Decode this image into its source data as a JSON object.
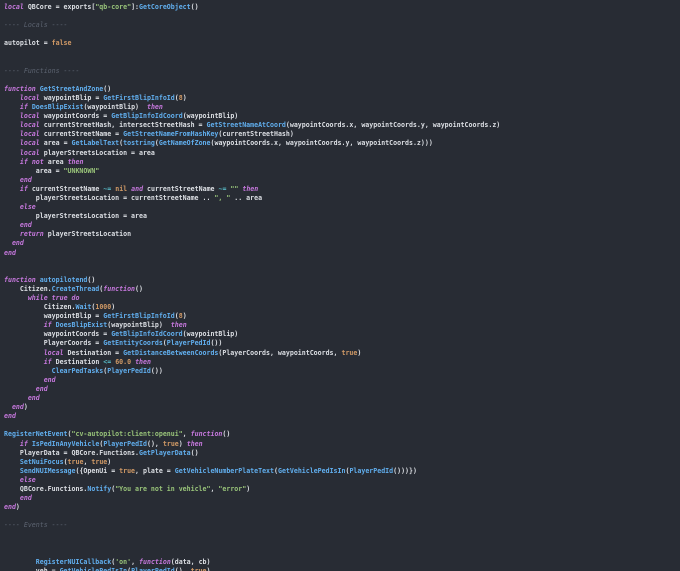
{
  "colors": {
    "background": "#282c34",
    "text": "#dcdfe4",
    "keyword": "#c678dd",
    "function": "#61afef",
    "string": "#98c379",
    "number": "#d19a66",
    "operator": "#56b6c2",
    "comment": "#5c6370"
  },
  "lines": [
    [
      {
        "t": "kw",
        "v": "local"
      },
      {
        "t": "tx",
        "v": " QBCore = exports["
      },
      {
        "t": "str",
        "v": "\"qb-core\""
      },
      {
        "t": "tx",
        "v": "]:"
      },
      {
        "t": "fn",
        "v": "GetCoreObject"
      },
      {
        "t": "tx",
        "v": "()"
      }
    ],
    [],
    [
      {
        "t": "cm",
        "v": "---- Locals ----"
      }
    ],
    [],
    [
      {
        "t": "tx",
        "v": "autopilot = "
      },
      {
        "t": "num",
        "v": "false"
      }
    ],
    [],
    [],
    [
      {
        "t": "cm",
        "v": "---- Functions ----"
      }
    ],
    [],
    [
      {
        "t": "kw",
        "v": "function"
      },
      {
        "t": "tx",
        "v": " "
      },
      {
        "t": "fn",
        "v": "GetStreetAndZone"
      },
      {
        "t": "tx",
        "v": "()"
      }
    ],
    [
      {
        "t": "tx",
        "v": "    "
      },
      {
        "t": "kw",
        "v": "local"
      },
      {
        "t": "tx",
        "v": " waypointBlip = "
      },
      {
        "t": "fn",
        "v": "GetFirstBlipInfoId"
      },
      {
        "t": "tx",
        "v": "("
      },
      {
        "t": "num",
        "v": "8"
      },
      {
        "t": "tx",
        "v": ")"
      }
    ],
    [
      {
        "t": "tx",
        "v": "    "
      },
      {
        "t": "kw",
        "v": "if"
      },
      {
        "t": "tx",
        "v": " "
      },
      {
        "t": "fn",
        "v": "DoesBlipExist"
      },
      {
        "t": "tx",
        "v": "(waypointBlip)  "
      },
      {
        "t": "kw",
        "v": "then"
      }
    ],
    [
      {
        "t": "tx",
        "v": "    "
      },
      {
        "t": "kw",
        "v": "local"
      },
      {
        "t": "tx",
        "v": " waypointCoords = "
      },
      {
        "t": "fn",
        "v": "GetBlipInfoIdCoord"
      },
      {
        "t": "tx",
        "v": "(waypointBlip)"
      }
    ],
    [
      {
        "t": "tx",
        "v": "    "
      },
      {
        "t": "kw",
        "v": "local"
      },
      {
        "t": "tx",
        "v": " currentStreetHash, intersectStreetHash = "
      },
      {
        "t": "fn",
        "v": "GetStreetNameAtCoord"
      },
      {
        "t": "tx",
        "v": "(waypointCoords.x, waypointCoords.y, waypointCoords.z)"
      }
    ],
    [
      {
        "t": "tx",
        "v": "    "
      },
      {
        "t": "kw",
        "v": "local"
      },
      {
        "t": "tx",
        "v": " currentStreetName = "
      },
      {
        "t": "fn",
        "v": "GetStreetNameFromHashKey"
      },
      {
        "t": "tx",
        "v": "(currentStreetHash)"
      }
    ],
    [
      {
        "t": "tx",
        "v": "    "
      },
      {
        "t": "kw",
        "v": "local"
      },
      {
        "t": "tx",
        "v": " area = "
      },
      {
        "t": "fn",
        "v": "GetLabelText"
      },
      {
        "t": "tx",
        "v": "("
      },
      {
        "t": "fn",
        "v": "tostring"
      },
      {
        "t": "tx",
        "v": "("
      },
      {
        "t": "fn",
        "v": "GetNameOfZone"
      },
      {
        "t": "tx",
        "v": "(waypointCoords.x, waypointCoords.y, waypointCoords.z)))"
      }
    ],
    [
      {
        "t": "tx",
        "v": "    "
      },
      {
        "t": "kw",
        "v": "local"
      },
      {
        "t": "tx",
        "v": " playerStreetsLocation = area"
      }
    ],
    [
      {
        "t": "tx",
        "v": "    "
      },
      {
        "t": "kw",
        "v": "if"
      },
      {
        "t": "tx",
        "v": " "
      },
      {
        "t": "kw",
        "v": "not"
      },
      {
        "t": "tx",
        "v": " area "
      },
      {
        "t": "kw",
        "v": "then"
      }
    ],
    [
      {
        "t": "tx",
        "v": "        area = "
      },
      {
        "t": "str",
        "v": "\"UNKNOWN\""
      }
    ],
    [
      {
        "t": "tx",
        "v": "    "
      },
      {
        "t": "kw",
        "v": "end"
      }
    ],
    [
      {
        "t": "tx",
        "v": "    "
      },
      {
        "t": "kw",
        "v": "if"
      },
      {
        "t": "tx",
        "v": " currentStreetName "
      },
      {
        "t": "op",
        "v": "~="
      },
      {
        "t": "tx",
        "v": " "
      },
      {
        "t": "num",
        "v": "nil"
      },
      {
        "t": "tx",
        "v": " "
      },
      {
        "t": "kw",
        "v": "and"
      },
      {
        "t": "tx",
        "v": " currentStreetName "
      },
      {
        "t": "op",
        "v": "~="
      },
      {
        "t": "tx",
        "v": " "
      },
      {
        "t": "str",
        "v": "\"\""
      },
      {
        "t": "tx",
        "v": " "
      },
      {
        "t": "kw",
        "v": "then"
      }
    ],
    [
      {
        "t": "tx",
        "v": "        playerStreetsLocation = currentStreetName .. "
      },
      {
        "t": "str",
        "v": "\", \""
      },
      {
        "t": "tx",
        "v": " .. area"
      }
    ],
    [
      {
        "t": "tx",
        "v": "    "
      },
      {
        "t": "kw",
        "v": "else"
      }
    ],
    [
      {
        "t": "tx",
        "v": "        playerStreetsLocation = area"
      }
    ],
    [
      {
        "t": "tx",
        "v": "    "
      },
      {
        "t": "kw",
        "v": "end"
      }
    ],
    [
      {
        "t": "tx",
        "v": "    "
      },
      {
        "t": "kw",
        "v": "return"
      },
      {
        "t": "tx",
        "v": " playerStreetsLocation"
      }
    ],
    [
      {
        "t": "tx",
        "v": "  "
      },
      {
        "t": "kw",
        "v": "end"
      }
    ],
    [
      {
        "t": "kw",
        "v": "end"
      }
    ],
    [],
    [],
    [
      {
        "t": "kw",
        "v": "function"
      },
      {
        "t": "tx",
        "v": " "
      },
      {
        "t": "fn",
        "v": "autopilotend"
      },
      {
        "t": "tx",
        "v": "()"
      }
    ],
    [
      {
        "t": "tx",
        "v": "    Citizen."
      },
      {
        "t": "fn",
        "v": "CreateThread"
      },
      {
        "t": "tx",
        "v": "("
      },
      {
        "t": "kw",
        "v": "function"
      },
      {
        "t": "tx",
        "v": "()"
      }
    ],
    [
      {
        "t": "tx",
        "v": "      "
      },
      {
        "t": "kw",
        "v": "while"
      },
      {
        "t": "tx",
        "v": " "
      },
      {
        "t": "kw",
        "v": "true"
      },
      {
        "t": "tx",
        "v": " "
      },
      {
        "t": "kw",
        "v": "do"
      }
    ],
    [
      {
        "t": "tx",
        "v": "          Citizen."
      },
      {
        "t": "fn",
        "v": "Wait"
      },
      {
        "t": "tx",
        "v": "("
      },
      {
        "t": "num",
        "v": "1000"
      },
      {
        "t": "tx",
        "v": ")"
      }
    ],
    [
      {
        "t": "tx",
        "v": "          waypointBlip = "
      },
      {
        "t": "fn",
        "v": "GetFirstBlipInfoId"
      },
      {
        "t": "tx",
        "v": "("
      },
      {
        "t": "num",
        "v": "8"
      },
      {
        "t": "tx",
        "v": ")"
      }
    ],
    [
      {
        "t": "tx",
        "v": "          "
      },
      {
        "t": "kw",
        "v": "if"
      },
      {
        "t": "tx",
        "v": " "
      },
      {
        "t": "fn",
        "v": "DoesBlipExist"
      },
      {
        "t": "tx",
        "v": "(waypointBlip)  "
      },
      {
        "t": "kw",
        "v": "then"
      }
    ],
    [
      {
        "t": "tx",
        "v": "          waypointCoords = "
      },
      {
        "t": "fn",
        "v": "GetBlipInfoIdCoord"
      },
      {
        "t": "tx",
        "v": "(waypointBlip)"
      }
    ],
    [
      {
        "t": "tx",
        "v": "          PlayerCoords = "
      },
      {
        "t": "fn",
        "v": "GetEntityCoords"
      },
      {
        "t": "tx",
        "v": "("
      },
      {
        "t": "fn",
        "v": "PlayerPedId"
      },
      {
        "t": "tx",
        "v": "())"
      }
    ],
    [
      {
        "t": "tx",
        "v": "          "
      },
      {
        "t": "kw",
        "v": "local"
      },
      {
        "t": "tx",
        "v": " Destination = "
      },
      {
        "t": "fn",
        "v": "GetDistanceBetweenCoords"
      },
      {
        "t": "tx",
        "v": "(PlayerCoords, waypointCoords, "
      },
      {
        "t": "num",
        "v": "true"
      },
      {
        "t": "tx",
        "v": ")"
      }
    ],
    [
      {
        "t": "tx",
        "v": "          "
      },
      {
        "t": "kw",
        "v": "if"
      },
      {
        "t": "tx",
        "v": " Destination "
      },
      {
        "t": "op",
        "v": "<="
      },
      {
        "t": "tx",
        "v": " "
      },
      {
        "t": "num",
        "v": "60.0"
      },
      {
        "t": "tx",
        "v": " "
      },
      {
        "t": "kw",
        "v": "then"
      }
    ],
    [
      {
        "t": "tx",
        "v": "            "
      },
      {
        "t": "fn",
        "v": "ClearPedTasks"
      },
      {
        "t": "tx",
        "v": "("
      },
      {
        "t": "fn",
        "v": "PlayerPedId"
      },
      {
        "t": "tx",
        "v": "())"
      }
    ],
    [
      {
        "t": "tx",
        "v": "          "
      },
      {
        "t": "kw",
        "v": "end"
      }
    ],
    [
      {
        "t": "tx",
        "v": "        "
      },
      {
        "t": "kw",
        "v": "end"
      }
    ],
    [
      {
        "t": "tx",
        "v": "      "
      },
      {
        "t": "kw",
        "v": "end"
      }
    ],
    [
      {
        "t": "tx",
        "v": "  "
      },
      {
        "t": "kw",
        "v": "end"
      },
      {
        "t": "tx",
        "v": ")"
      }
    ],
    [
      {
        "t": "kw",
        "v": "end"
      }
    ],
    [],
    [
      {
        "t": "fn",
        "v": "RegisterNetEvent"
      },
      {
        "t": "tx",
        "v": "("
      },
      {
        "t": "str",
        "v": "\"cv-autopilot:client:openui\""
      },
      {
        "t": "tx",
        "v": ", "
      },
      {
        "t": "kw",
        "v": "function"
      },
      {
        "t": "tx",
        "v": "()"
      }
    ],
    [
      {
        "t": "tx",
        "v": "    "
      },
      {
        "t": "kw",
        "v": "if"
      },
      {
        "t": "tx",
        "v": " "
      },
      {
        "t": "fn",
        "v": "IsPedInAnyVehicle"
      },
      {
        "t": "tx",
        "v": "("
      },
      {
        "t": "fn",
        "v": "PlayerPedId"
      },
      {
        "t": "tx",
        "v": "(), "
      },
      {
        "t": "num",
        "v": "true"
      },
      {
        "t": "tx",
        "v": ") "
      },
      {
        "t": "kw",
        "v": "then"
      }
    ],
    [
      {
        "t": "tx",
        "v": "    PlayerData = QBCore.Functions."
      },
      {
        "t": "fn",
        "v": "GetPlayerData"
      },
      {
        "t": "tx",
        "v": "()"
      }
    ],
    [
      {
        "t": "tx",
        "v": "    "
      },
      {
        "t": "fn",
        "v": "SetNuiFocus"
      },
      {
        "t": "tx",
        "v": "("
      },
      {
        "t": "num",
        "v": "true"
      },
      {
        "t": "tx",
        "v": ", "
      },
      {
        "t": "num",
        "v": "true"
      },
      {
        "t": "tx",
        "v": ")"
      }
    ],
    [
      {
        "t": "tx",
        "v": "    "
      },
      {
        "t": "fn",
        "v": "SendNUIMessage"
      },
      {
        "t": "tx",
        "v": "({OpenUi = "
      },
      {
        "t": "num",
        "v": "true"
      },
      {
        "t": "tx",
        "v": ", plate = "
      },
      {
        "t": "fn",
        "v": "GetVehicleNumberPlateText"
      },
      {
        "t": "tx",
        "v": "("
      },
      {
        "t": "fn",
        "v": "GetVehiclePedIsIn"
      },
      {
        "t": "tx",
        "v": "("
      },
      {
        "t": "fn",
        "v": "PlayerPedId"
      },
      {
        "t": "tx",
        "v": "()))})"
      }
    ],
    [
      {
        "t": "tx",
        "v": "    "
      },
      {
        "t": "kw",
        "v": "else"
      }
    ],
    [
      {
        "t": "tx",
        "v": "    QBCore.Functions."
      },
      {
        "t": "fn",
        "v": "Notify"
      },
      {
        "t": "tx",
        "v": "("
      },
      {
        "t": "str",
        "v": "\"You are not in vehicle\""
      },
      {
        "t": "tx",
        "v": ", "
      },
      {
        "t": "str",
        "v": "\"error\""
      },
      {
        "t": "tx",
        "v": ")"
      }
    ],
    [
      {
        "t": "tx",
        "v": "    "
      },
      {
        "t": "kw",
        "v": "end"
      }
    ],
    [
      {
        "t": "kw",
        "v": "end"
      },
      {
        "t": "tx",
        "v": ")"
      }
    ],
    [],
    [
      {
        "t": "cm",
        "v": "---- Events ----"
      }
    ],
    [],
    [],
    [],
    [
      {
        "t": "tx",
        "v": "        "
      },
      {
        "t": "fn",
        "v": "RegisterNUICallback"
      },
      {
        "t": "tx",
        "v": "("
      },
      {
        "t": "str",
        "v": "'on'"
      },
      {
        "t": "tx",
        "v": ", "
      },
      {
        "t": "kw",
        "v": "function"
      },
      {
        "t": "tx",
        "v": "(data, cb)"
      }
    ],
    [
      {
        "t": "tx",
        "v": "        veh = "
      },
      {
        "t": "fn",
        "v": "GetVehiclePedIsIn"
      },
      {
        "t": "tx",
        "v": "("
      },
      {
        "t": "fn",
        "v": "PlayerPedId"
      },
      {
        "t": "tx",
        "v": "(), "
      },
      {
        "t": "num",
        "v": "true"
      },
      {
        "t": "tx",
        "v": ")"
      }
    ]
  ]
}
